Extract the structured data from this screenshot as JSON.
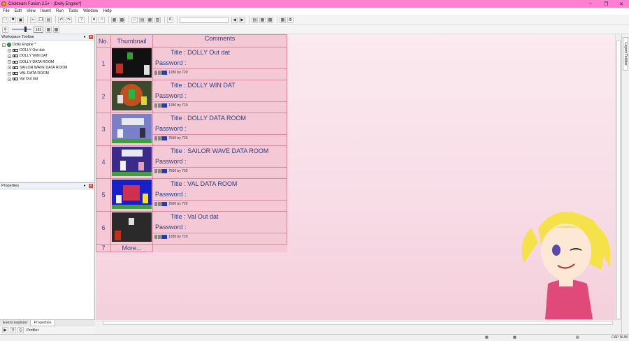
{
  "window": {
    "title": "Clickteam Fusion 2.5+ - [Dolly Engine*]",
    "minimize_icon": "minimize-icon",
    "restore_icon": "restore-icon",
    "close_icon": "close-icon"
  },
  "menu": [
    "File",
    "Edit",
    "View",
    "Insert",
    "Run",
    "Tools",
    "Window",
    "Help"
  ],
  "toolbar": {
    "zoom_value": "183"
  },
  "workspace": {
    "title": "Workspace Toolbar",
    "tree": [
      {
        "label": "Dolly Engine *",
        "root": true
      },
      {
        "label": "DOLLY Out dat"
      },
      {
        "label": "DOLLY WIN DAT"
      },
      {
        "label": "DOLLY DATA ROOM"
      },
      {
        "label": "SAILOR WAVE DATA ROOM"
      },
      {
        "label": "VAL DATA ROOM"
      },
      {
        "label": "Val Out dat"
      }
    ]
  },
  "properties": {
    "title": "Properties"
  },
  "bottom_tabs": [
    "Event explorer",
    "Properties"
  ],
  "bottom_tools": {
    "profiler": "Profiler"
  },
  "table": {
    "headers": {
      "no": "No.",
      "thumbnail": "Thumbnail",
      "comments": "Comments"
    },
    "rows": [
      {
        "no": "1",
        "title": "Title : DOLLY Out dat",
        "password": "Password :",
        "size": "1280 by 720",
        "bg": "#111111",
        "accent": "#c03020"
      },
      {
        "no": "2",
        "title": "Title : DOLLY WIN DAT",
        "password": "Password :",
        "size": "1280 by 720",
        "bg": "#3a4a2a",
        "accent": "#d06020"
      },
      {
        "no": "3",
        "title": "Title : DOLLY DATA ROOM",
        "password": "Password :",
        "size": "7500 by 720",
        "bg": "#7a80c8",
        "accent": "#f0f0f0"
      },
      {
        "no": "4",
        "title": "Title : SAILOR WAVE DATA ROOM",
        "password": "Password :",
        "size": "7500 by 720",
        "bg": "#3a2a8a",
        "accent": "#f0f0f0"
      },
      {
        "no": "5",
        "title": "Title : VAL DATA ROOM",
        "password": "Password :",
        "size": "7500 by 720",
        "bg": "#1820c8",
        "accent": "#e04060"
      },
      {
        "no": "6",
        "title": "Title : Val Out dat",
        "password": "Password :",
        "size": "1280 by 720",
        "bg": "#2a2a2a",
        "accent": "#e0e0e0"
      }
    ],
    "more": {
      "no": "7",
      "label": "More..."
    }
  },
  "layers_toolbar": "Layers Toolbar",
  "status": {
    "caps": "CAP NUM"
  }
}
